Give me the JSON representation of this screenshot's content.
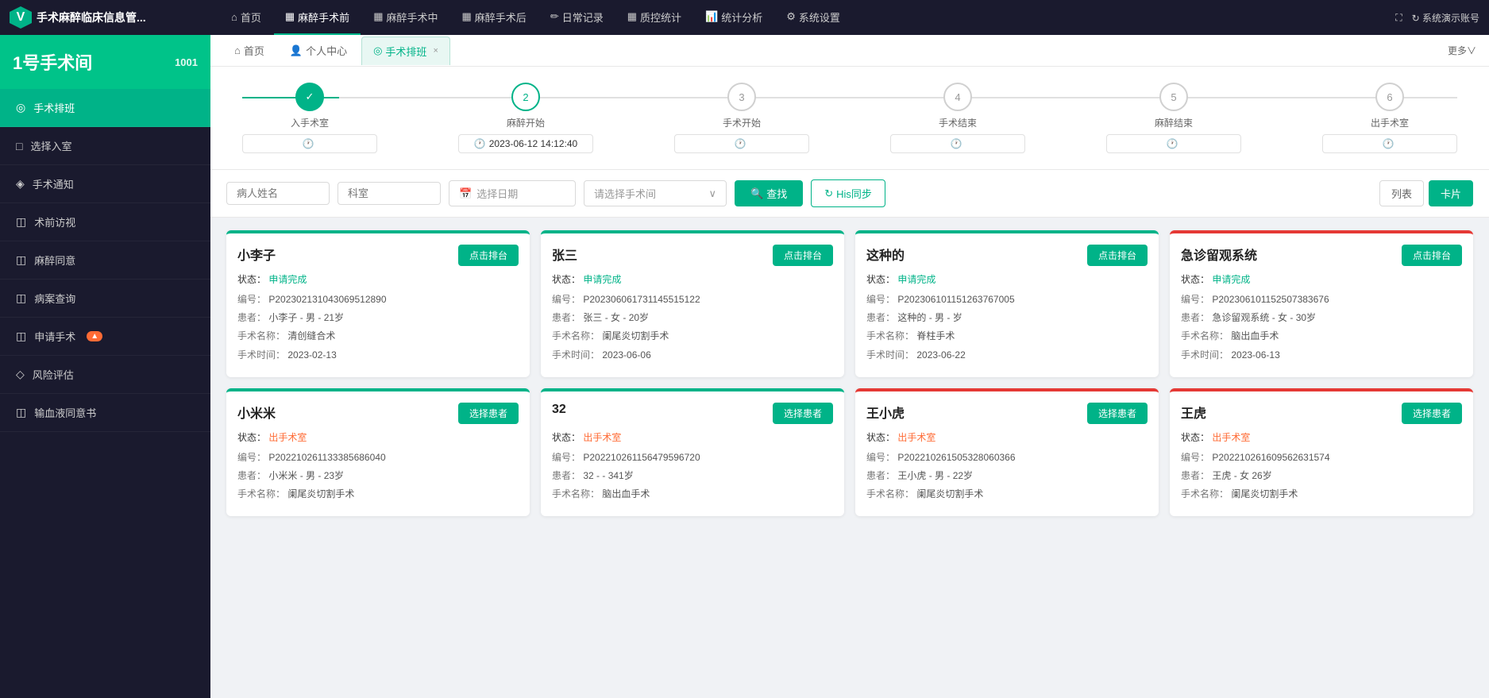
{
  "app": {
    "title": "手术麻醉临床信息管...",
    "logo_icon": "V"
  },
  "top_nav": {
    "items": [
      {
        "label": "首页",
        "icon": "⌂",
        "active": false
      },
      {
        "label": "麻醉手术前",
        "icon": "▦",
        "active": true
      },
      {
        "label": "麻醉手术中",
        "icon": "▦",
        "active": false
      },
      {
        "label": "麻醉手术后",
        "icon": "▦",
        "active": false
      },
      {
        "label": "日常记录",
        "icon": "✏",
        "active": false
      },
      {
        "label": "质控统计",
        "icon": "▦",
        "active": false
      },
      {
        "label": "统计分析",
        "icon": "📊",
        "active": false
      },
      {
        "label": "系统设置",
        "icon": "⚙",
        "active": false
      }
    ],
    "right_items": [
      {
        "label": "⛶",
        "name": "fullscreen"
      },
      {
        "label": "↻ 系统演示账号"
      }
    ]
  },
  "sidebar": {
    "room_name": "1号手术间",
    "room_id": "1001",
    "menu_items": [
      {
        "icon": "◎",
        "label": "手术排班",
        "active": true
      },
      {
        "icon": "□",
        "label": "选择入室",
        "active": false
      },
      {
        "icon": "◈",
        "label": "手术通知",
        "active": false
      },
      {
        "icon": "◫",
        "label": "术前访视",
        "active": false
      },
      {
        "icon": "◫",
        "label": "麻醉同意",
        "active": false
      },
      {
        "icon": "◫",
        "label": "病案查询",
        "active": false
      },
      {
        "icon": "◫",
        "label": "申请手术",
        "active": false,
        "warn": "▲"
      },
      {
        "icon": "◇",
        "label": "风险评估",
        "active": false
      },
      {
        "icon": "◫",
        "label": "输血液同意书",
        "active": false
      }
    ]
  },
  "tabs": {
    "items": [
      {
        "label": "首页",
        "icon": "⌂",
        "closable": false,
        "active": false
      },
      {
        "label": "个人中心",
        "icon": "👤",
        "closable": false,
        "active": false
      },
      {
        "label": "手术排班",
        "icon": "◎",
        "closable": true,
        "active": true
      }
    ],
    "more_label": "更多∨"
  },
  "progress": {
    "steps": [
      {
        "label": "入手术室",
        "status": "done",
        "time": "",
        "icon": "✓",
        "num": "1"
      },
      {
        "label": "麻醉开始",
        "status": "active",
        "time": "2023-06-12 14:12:40",
        "icon": "2",
        "num": "2"
      },
      {
        "label": "手术开始",
        "status": "pending",
        "time": "",
        "icon": "3",
        "num": "3"
      },
      {
        "label": "手术结束",
        "status": "pending",
        "time": "",
        "icon": "4",
        "num": "4"
      },
      {
        "label": "麻醉结束",
        "status": "pending",
        "time": "",
        "icon": "5",
        "num": "5"
      },
      {
        "label": "出手术室",
        "status": "pending",
        "time": "",
        "icon": "6",
        "num": "6"
      }
    ]
  },
  "filter": {
    "patient_name_placeholder": "病人姓名",
    "department_placeholder": "科室",
    "date_placeholder": "选择日期",
    "room_placeholder": "请选择手术间",
    "search_label": "查找",
    "his_sync_label": "His同步",
    "view_list_label": "列表",
    "view_card_label": "卡片"
  },
  "cards_row1": [
    {
      "name": "小李子",
      "action_label": "点击排台",
      "status_label": "状态：",
      "status_value": "申请完成",
      "border_color": "green",
      "fields": [
        {
          "label": "编号：",
          "value": "P20230213104306951289​0"
        },
        {
          "label": "患者：",
          "value": "小李子 - 男 - 21岁"
        },
        {
          "label": "手术名称：",
          "value": "清创缝合术"
        },
        {
          "label": "手术时间：",
          "value": "2023-02-13"
        }
      ]
    },
    {
      "name": "张三",
      "action_label": "点击排台",
      "status_label": "状态：",
      "status_value": "申请完成",
      "border_color": "green",
      "fields": [
        {
          "label": "编号：",
          "value": "P20230606173114551512​2"
        },
        {
          "label": "患者：",
          "value": "张三 - 女 - 20岁"
        },
        {
          "label": "手术名称：",
          "value": "阑尾炎切割手术"
        },
        {
          "label": "手术时间：",
          "value": "2023-06-06"
        }
      ]
    },
    {
      "name": "这种的",
      "action_label": "点击排台",
      "status_label": "状态：",
      "status_value": "申请完成",
      "border_color": "green",
      "fields": [
        {
          "label": "编号：",
          "value": "P20230610115126376700​5"
        },
        {
          "label": "患者：",
          "value": "这种的 - 男 - 岁"
        },
        {
          "label": "手术名称：",
          "value": "脊柱手术"
        },
        {
          "label": "手术时间：",
          "value": "2023-06-22"
        }
      ]
    },
    {
      "name": "急诊留观系统",
      "action_label": "点击排台",
      "status_label": "状态：",
      "status_value": "申请完成",
      "border_color": "red",
      "fields": [
        {
          "label": "编号：",
          "value": "P20230610115250738367​6"
        },
        {
          "label": "患者：",
          "value": "急诊留观系统 - 女 - 30岁"
        },
        {
          "label": "手术名称：",
          "value": "脑出血手术"
        },
        {
          "label": "手术时间：",
          "value": "2023-06-13"
        }
      ]
    }
  ],
  "cards_row2": [
    {
      "name": "小米米",
      "action_label": "选择患者",
      "status_label": "状态：",
      "status_value": "出手术室",
      "border_color": "green",
      "status_color": "orange",
      "fields": [
        {
          "label": "编号：",
          "value": "P20221026113338568604​0"
        },
        {
          "label": "患者：",
          "value": "小米米 - 男 - 23岁"
        },
        {
          "label": "手术名称：",
          "value": "阑尾炎切割手术"
        }
      ]
    },
    {
      "name": "32",
      "action_label": "选择患者",
      "status_label": "状态：",
      "status_value": "出手术室",
      "border_color": "green",
      "status_color": "orange",
      "fields": [
        {
          "label": "编号：",
          "value": "P20221026115647959672​0"
        },
        {
          "label": "患者：",
          "value": "32 - - 341岁"
        },
        {
          "label": "手术名称：",
          "value": "脑出血手术"
        }
      ]
    },
    {
      "name": "王小虎",
      "action_label": "选择患者",
      "status_label": "状态：",
      "status_value": "出手术室",
      "border_color": "red",
      "status_color": "orange",
      "fields": [
        {
          "label": "编号：",
          "value": "P20221026150532806036​6"
        },
        {
          "label": "患者：",
          "value": "王小虎 - 男 - 22岁"
        },
        {
          "label": "手术名称：",
          "value": "阑尾炎切割手术"
        }
      ]
    },
    {
      "name": "王虎",
      "action_label": "选择患者",
      "status_label": "状态：",
      "status_value": "出手术室",
      "border_color": "red",
      "status_color": "orange",
      "fields": [
        {
          "label": "编号：",
          "value": "P20221026160956263157​4"
        },
        {
          "label": "患者：",
          "value": "王虎 - 女 26岁"
        },
        {
          "label": "手术名称：",
          "value": "阑尾炎切割手术"
        }
      ]
    }
  ]
}
